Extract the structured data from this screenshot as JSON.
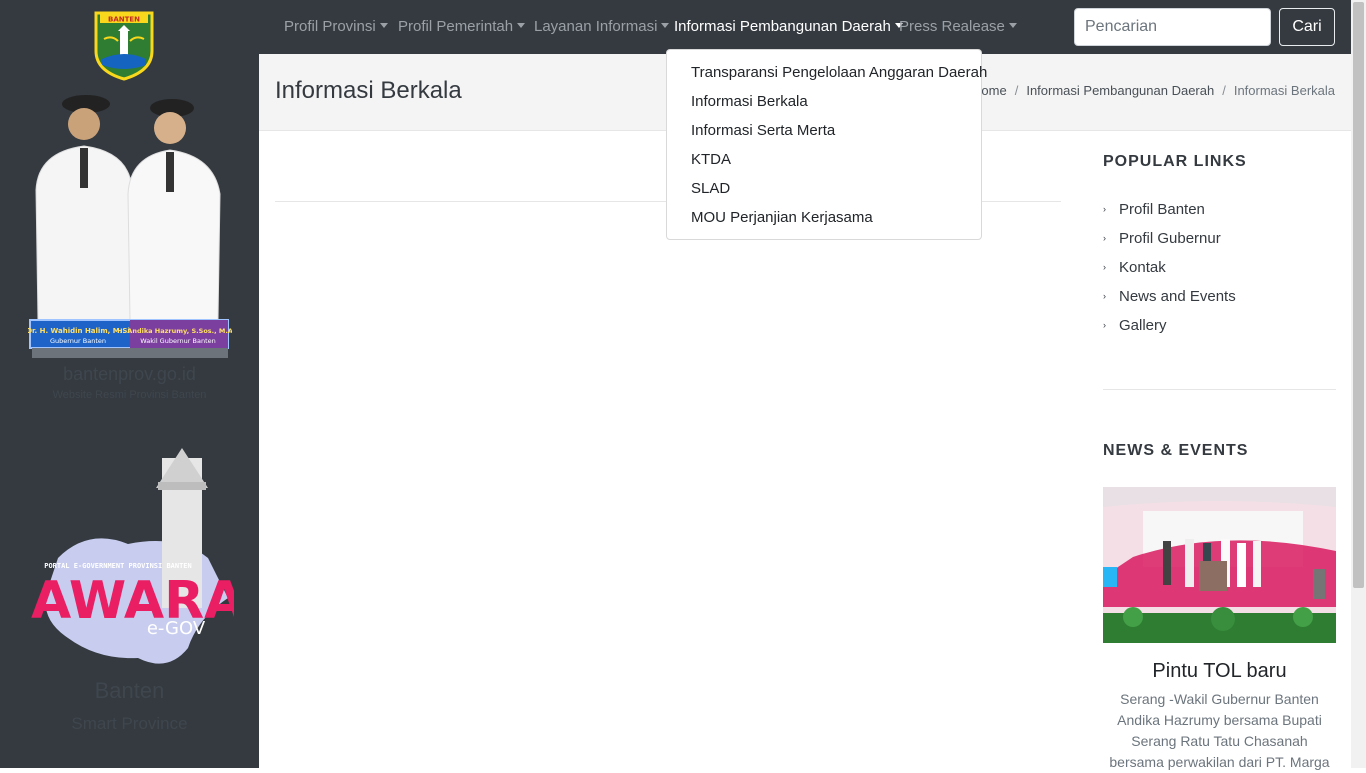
{
  "sidebar": {
    "emblem_text": "BANTEN",
    "leaders": [
      {
        "name": "Dr. H. Wahidin Halim, M.Si",
        "role": "Gubernur Banten"
      },
      {
        "name": "H. Andika Hazrumy, S.Sos., M.AP.",
        "role": "Wakil Gubernur Banten"
      }
    ],
    "site_domain": "bantenprov.go.id",
    "site_sub": "Website Resmi Provinsi Banten",
    "jawara_top": "PORTAL E-GOVERNMENT PROVINSI BANTEN",
    "jawara_word": "JAWARA",
    "jawara_sub": "e-GOV",
    "region": "Banten",
    "tagline": "Smart Province"
  },
  "nav": {
    "items": [
      {
        "label": "Profil Provinsi"
      },
      {
        "label": "Profil Pemerintah"
      },
      {
        "label": "Layanan Informasi"
      },
      {
        "label": "Informasi Pembangunan Daerah"
      },
      {
        "label": "Press Realease"
      }
    ],
    "search_placeholder": "Pencarian",
    "search_button": "Cari"
  },
  "dropdown": {
    "items": [
      "Transparansi Pengelolaan Anggaran Daerah",
      "Informasi Berkala",
      "Informasi Serta Merta",
      "KTDA",
      "SLAD",
      "MOU Perjanjian Kerjasama"
    ]
  },
  "header": {
    "title": "Informasi Berkala",
    "breadcrumb": [
      "Home",
      "Informasi Pembangunan Daerah",
      "Informasi Berkala"
    ]
  },
  "aside": {
    "popular_heading": "POPULAR LINKS",
    "links": [
      "Profil Banten",
      "Profil Gubernur",
      "Kontak",
      "News and Events",
      "Gallery"
    ],
    "news_heading": "NEWS & EVENTS",
    "news": {
      "title": "Pintu TOL baru",
      "excerpt": "Serang -Wakil Gubernur Banten Andika Hazrumy bersama Bupati Serang Ratu Tatu Chasanah bersama perwakilan dari PT. Marga"
    }
  },
  "colors": {
    "navbar": "#343a40",
    "sidebar": "#343a40",
    "header_bg": "#f4f4f4",
    "nav_text": "#9aa0a6",
    "nav_active": "#ffffff"
  }
}
